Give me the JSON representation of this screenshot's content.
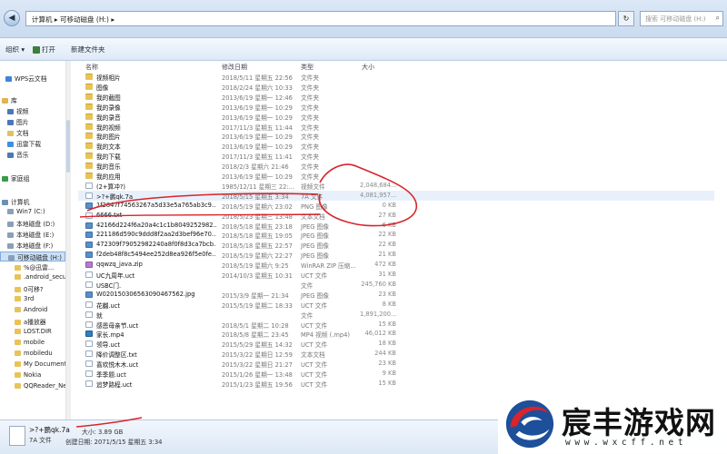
{
  "address": {
    "path_label": "计算机 ▸ 可移动磁盘 (H:) ▸",
    "search_placeholder": "搜索 可移动磁盘 (H:)",
    "back": "◀",
    "forward": "▶",
    "refresh": "↻"
  },
  "toolbar": {
    "organize": "组织 ▾",
    "open": "打开",
    "new_folder": "新建文件夹"
  },
  "nav": [
    {
      "label": "WPS云文档",
      "icon": "cloud",
      "color": "#3b86d8"
    },
    {
      "label": "库",
      "icon": "library",
      "color": "#e0b54a"
    },
    {
      "label": "视频",
      "icon": "video",
      "color": "#4a78b8"
    },
    {
      "label": "图片",
      "icon": "picture",
      "color": "#4a78b8"
    },
    {
      "label": "文档",
      "icon": "document",
      "color": "#e2c260"
    },
    {
      "label": "迅雷下载",
      "icon": "download",
      "color": "#3f8fdc"
    },
    {
      "label": "音乐",
      "icon": "music",
      "color": "#4a78b8"
    },
    {
      "label": "家庭组",
      "icon": "homegroup",
      "color": "#3a9b49"
    },
    {
      "label": "计算机",
      "icon": "computer",
      "color": "#6a8fb8"
    },
    {
      "label": "Win7 (C:)",
      "icon": "drive",
      "color": "#8aa0b8"
    },
    {
      "label": "本地磁盘 (D:)",
      "icon": "drive",
      "color": "#8aa0b8"
    },
    {
      "label": "本地磁盘 (E:)",
      "icon": "drive",
      "color": "#8aa0b8"
    },
    {
      "label": "本地磁盘 (F:)",
      "icon": "drive",
      "color": "#8aa0b8"
    },
    {
      "label": "可移动磁盘 (H:)",
      "icon": "usb-drive",
      "color": "#8aa0b8",
      "selected": true
    },
    {
      "label": "%@迅雷...",
      "icon": "folder",
      "color": "#e8c357"
    },
    {
      "label": ".android_secure",
      "icon": "folder",
      "color": "#e8c357"
    },
    {
      "label": "0可移?",
      "icon": "folder",
      "color": "#e8c357"
    },
    {
      "label": "3rd",
      "icon": "folder",
      "color": "#e8c357"
    },
    {
      "label": "Android",
      "icon": "folder",
      "color": "#e8c357"
    },
    {
      "label": "a播放器",
      "icon": "folder",
      "color": "#e8c357"
    },
    {
      "label": "LOST.DIR",
      "icon": "folder",
      "color": "#e8c357"
    },
    {
      "label": "mobile",
      "icon": "folder",
      "color": "#e8c357"
    },
    {
      "label": "mobiledu",
      "icon": "folder",
      "color": "#e8c357"
    },
    {
      "label": "My Documents",
      "icon": "folder",
      "color": "#e8c357"
    },
    {
      "label": "Nokia",
      "icon": "folder",
      "color": "#e8c357"
    },
    {
      "label": "QQReader_New",
      "icon": "folder",
      "color": "#e8c357"
    }
  ],
  "columns": {
    "name": "名称",
    "date": "修改日期",
    "type": "类型",
    "size": "大小"
  },
  "files": [
    {
      "name": "视频相片",
      "date": "2018/5/11 星期五 22:56",
      "type": "文件夹",
      "size": "",
      "kind": "folder"
    },
    {
      "name": "图像",
      "date": "2018/2/24 星期六 10:33",
      "type": "文件夹",
      "size": "",
      "kind": "folder"
    },
    {
      "name": "我的截图",
      "date": "2013/6/19 星期一 12:46",
      "type": "文件夹",
      "size": "",
      "kind": "folder"
    },
    {
      "name": "我的录像",
      "date": "2013/6/19 星期一 10:29",
      "type": "文件夹",
      "size": "",
      "kind": "folder"
    },
    {
      "name": "我的录音",
      "date": "2013/6/19 星期一 10:29",
      "type": "文件夹",
      "size": "",
      "kind": "folder"
    },
    {
      "name": "我的视频",
      "date": "2017/11/3 星期五 11:44",
      "type": "文件夹",
      "size": "",
      "kind": "folder"
    },
    {
      "name": "我的图片",
      "date": "2013/6/19 星期一 10:29",
      "type": "文件夹",
      "size": "",
      "kind": "folder"
    },
    {
      "name": "我的文本",
      "date": "2013/6/19 星期一 10:29",
      "type": "文件夹",
      "size": "",
      "kind": "folder"
    },
    {
      "name": "我的下载",
      "date": "2017/11/3 星期五 11:41",
      "type": "文件夹",
      "size": "",
      "kind": "folder"
    },
    {
      "name": "我的音乐",
      "date": "2018/2/3 星期六 21:46",
      "type": "文件夹",
      "size": "",
      "kind": "folder"
    },
    {
      "name": "我的应用",
      "date": "2013/6/19 星期一 10:29",
      "type": "文件夹",
      "size": "",
      "kind": "folder"
    },
    {
      "name": "(2+算冲?)",
      "date": "1985/12/11 星期三 22:...",
      "type": "视频文件",
      "size": "2,048,684...",
      "kind": "file"
    },
    {
      "name": ">?+鹏qk.7a",
      "date": "2018/5/15 星期五 3:34",
      "type": "7A 文件",
      "size": "4,081,957...",
      "kind": "file",
      "highlight": true
    },
    {
      "name": "1f2847f74563267a5d33e5a765ab3c9...",
      "date": "2018/5/19 星期六 23:02",
      "type": "PNG 图像",
      "size": "0 KB",
      "kind": "image"
    },
    {
      "name": "6666.txt",
      "date": "2018/5/23 星期三 13:48",
      "type": "文本文档",
      "size": "27 KB",
      "kind": "file"
    },
    {
      "name": "42166d224f6a20a4c1c1b8049252982...",
      "date": "2018/5/18 星期五 23:18",
      "type": "JPEG 图像",
      "size": "6 KB",
      "kind": "image"
    },
    {
      "name": "221186d590c9ddd8f2aa2d3bef96e70...",
      "date": "2018/5/18 星期五 19:05",
      "type": "JPEG 图像",
      "size": "22 KB",
      "kind": "image"
    },
    {
      "name": "472309f79052982240a8f0f8d3ca7bcb...",
      "date": "2018/5/18 星期五 22:57",
      "type": "JPEG 图像",
      "size": "22 KB",
      "kind": "image"
    },
    {
      "name": "f2deb48f8c5494ee252d8ea926f5e0fe...",
      "date": "2018/5/19 星期六 22:27",
      "type": "JPEG 图像",
      "size": "21 KB",
      "kind": "image"
    },
    {
      "name": "qqwzq_java.zip",
      "date": "2018/5/19 星期六 9:25",
      "type": "WinRAR ZIP 压缩...",
      "size": "472 KB",
      "kind": "zip"
    },
    {
      "name": "UC九周年.uct",
      "date": "2014/10/3 星期五 10:31",
      "type": "UCT 文件",
      "size": "31 KB",
      "kind": "file"
    },
    {
      "name": "USBC门.",
      "date": "",
      "type": "文件",
      "size": "245,760 KB",
      "kind": "file"
    },
    {
      "name": "W020150306563090467562.jpg",
      "date": "2015/3/9 星期一 21:34",
      "type": "JPEG 图像",
      "size": "23 KB",
      "kind": "image"
    },
    {
      "name": "花樾.uct",
      "date": "2015/5/19 星期二 18:33",
      "type": "UCT 文件",
      "size": "8 KB",
      "kind": "file"
    },
    {
      "name": "就",
      "date": "",
      "type": "文件",
      "size": "1,891,200...",
      "kind": "file"
    },
    {
      "name": "感恩母亲节.uct",
      "date": "2018/5/1 星期二 10:28",
      "type": "UCT 文件",
      "size": "15 KB",
      "kind": "file"
    },
    {
      "name": "家长.mp4",
      "date": "2018/5/8 星期二 23:45",
      "type": "MP4 视频 (.mp4)",
      "size": "46,012 KB",
      "kind": "video"
    },
    {
      "name": "领导.uct",
      "date": "2015/5/29 星期五 14:32",
      "type": "UCT 文件",
      "size": "18 KB",
      "kind": "file"
    },
    {
      "name": "降价调整区.txt",
      "date": "2015/3/22 星期日 12:59",
      "type": "文本文档",
      "size": "244 KB",
      "kind": "file"
    },
    {
      "name": "喜欢悦木木.uct",
      "date": "2015/3/22 星期日 21:27",
      "type": "UCT 文件",
      "size": "23 KB",
      "kind": "file"
    },
    {
      "name": "季季题.uct",
      "date": "2015/1/26 星期一 13:48",
      "type": "UCT 文件",
      "size": "9 KB",
      "kind": "file"
    },
    {
      "name": "追梦路程.uct",
      "date": "2015/1/23 星期五 19:56",
      "type": "UCT 文件",
      "size": "15 KB",
      "kind": "file"
    }
  ],
  "details": {
    "name": ">?+鹏qk.7a",
    "type": "7A 文件",
    "size": "大小: 3.89 GB",
    "modified": "创建日期: 2071/5/15 星期五 3:34"
  },
  "watermark": {
    "title": "宸丰游戏网",
    "url": "www.wxcff.net"
  },
  "colors": {
    "annotation": "#d8242a",
    "selection": "#cce1f7",
    "logo_red": "#d8242a",
    "logo_blue": "#1d4f9a"
  }
}
